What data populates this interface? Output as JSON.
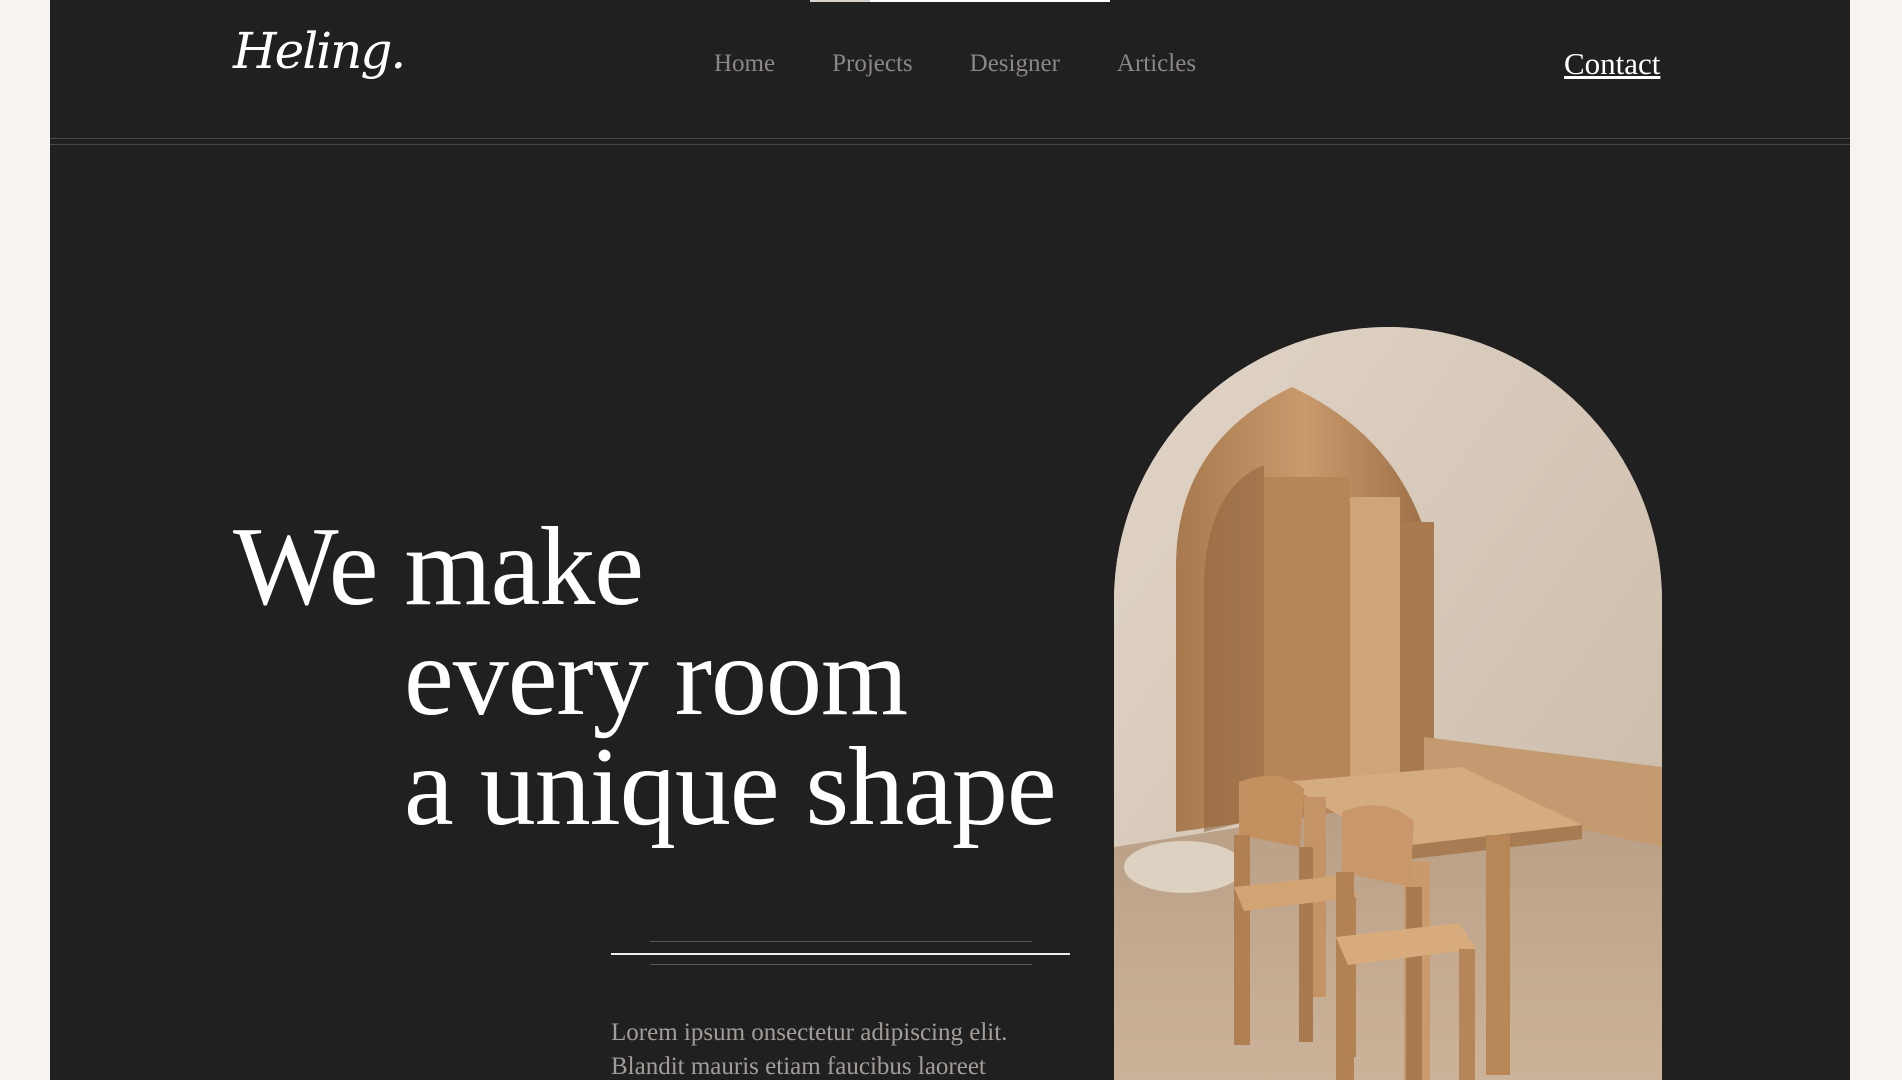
{
  "brand": {
    "logo_text": "Heling."
  },
  "nav": {
    "items": [
      {
        "label": "Home"
      },
      {
        "label": "Projects"
      },
      {
        "label": "Designer"
      },
      {
        "label": "Articles"
      }
    ],
    "contact_label": "Contact"
  },
  "hero": {
    "headline": {
      "line1": "We make",
      "line2": "every room",
      "line3": "a unique shape"
    },
    "body": "Lorem ipsum onsectetur adipiscing elit. Blandit mauris etiam faucibus laoreet"
  },
  "colors": {
    "page_bg": "#f8f3ee",
    "panel_bg": "#212020",
    "nav_text": "#8b8784",
    "heading_text": "#ffffff",
    "body_text": "#a29d98"
  }
}
